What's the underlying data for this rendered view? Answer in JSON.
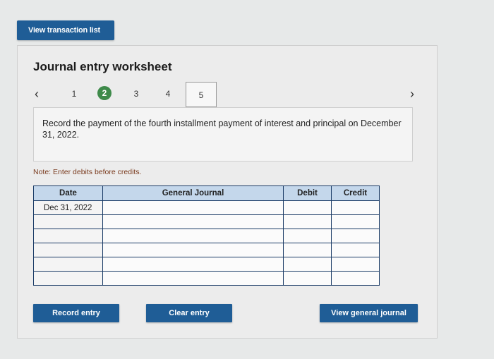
{
  "top_button": {
    "label": "View transaction list"
  },
  "worksheet": {
    "title": "Journal entry worksheet",
    "steps": [
      "1",
      "2",
      "3",
      "4",
      "5"
    ],
    "active_step": "2",
    "selected_step": "5",
    "prompt": "Record the payment of the fourth installment payment of interest and principal on December 31, 2022.",
    "note": "Note: Enter debits before credits."
  },
  "table": {
    "headers": {
      "date": "Date",
      "journal": "General Journal",
      "debit": "Debit",
      "credit": "Credit"
    },
    "rows": [
      {
        "date": "Dec 31, 2022",
        "journal": "",
        "debit": "",
        "credit": ""
      },
      {
        "date": "",
        "journal": "",
        "debit": "",
        "credit": ""
      },
      {
        "date": "",
        "journal": "",
        "debit": "",
        "credit": ""
      },
      {
        "date": "",
        "journal": "",
        "debit": "",
        "credit": ""
      },
      {
        "date": "",
        "journal": "",
        "debit": "",
        "credit": ""
      },
      {
        "date": "",
        "journal": "",
        "debit": "",
        "credit": ""
      }
    ]
  },
  "buttons": {
    "record": "Record entry",
    "clear": "Clear entry",
    "view_journal": "View general journal"
  },
  "colors": {
    "primary": "#1f5d96",
    "active_step": "#3e8a4a",
    "header": "#c4d7eb"
  }
}
